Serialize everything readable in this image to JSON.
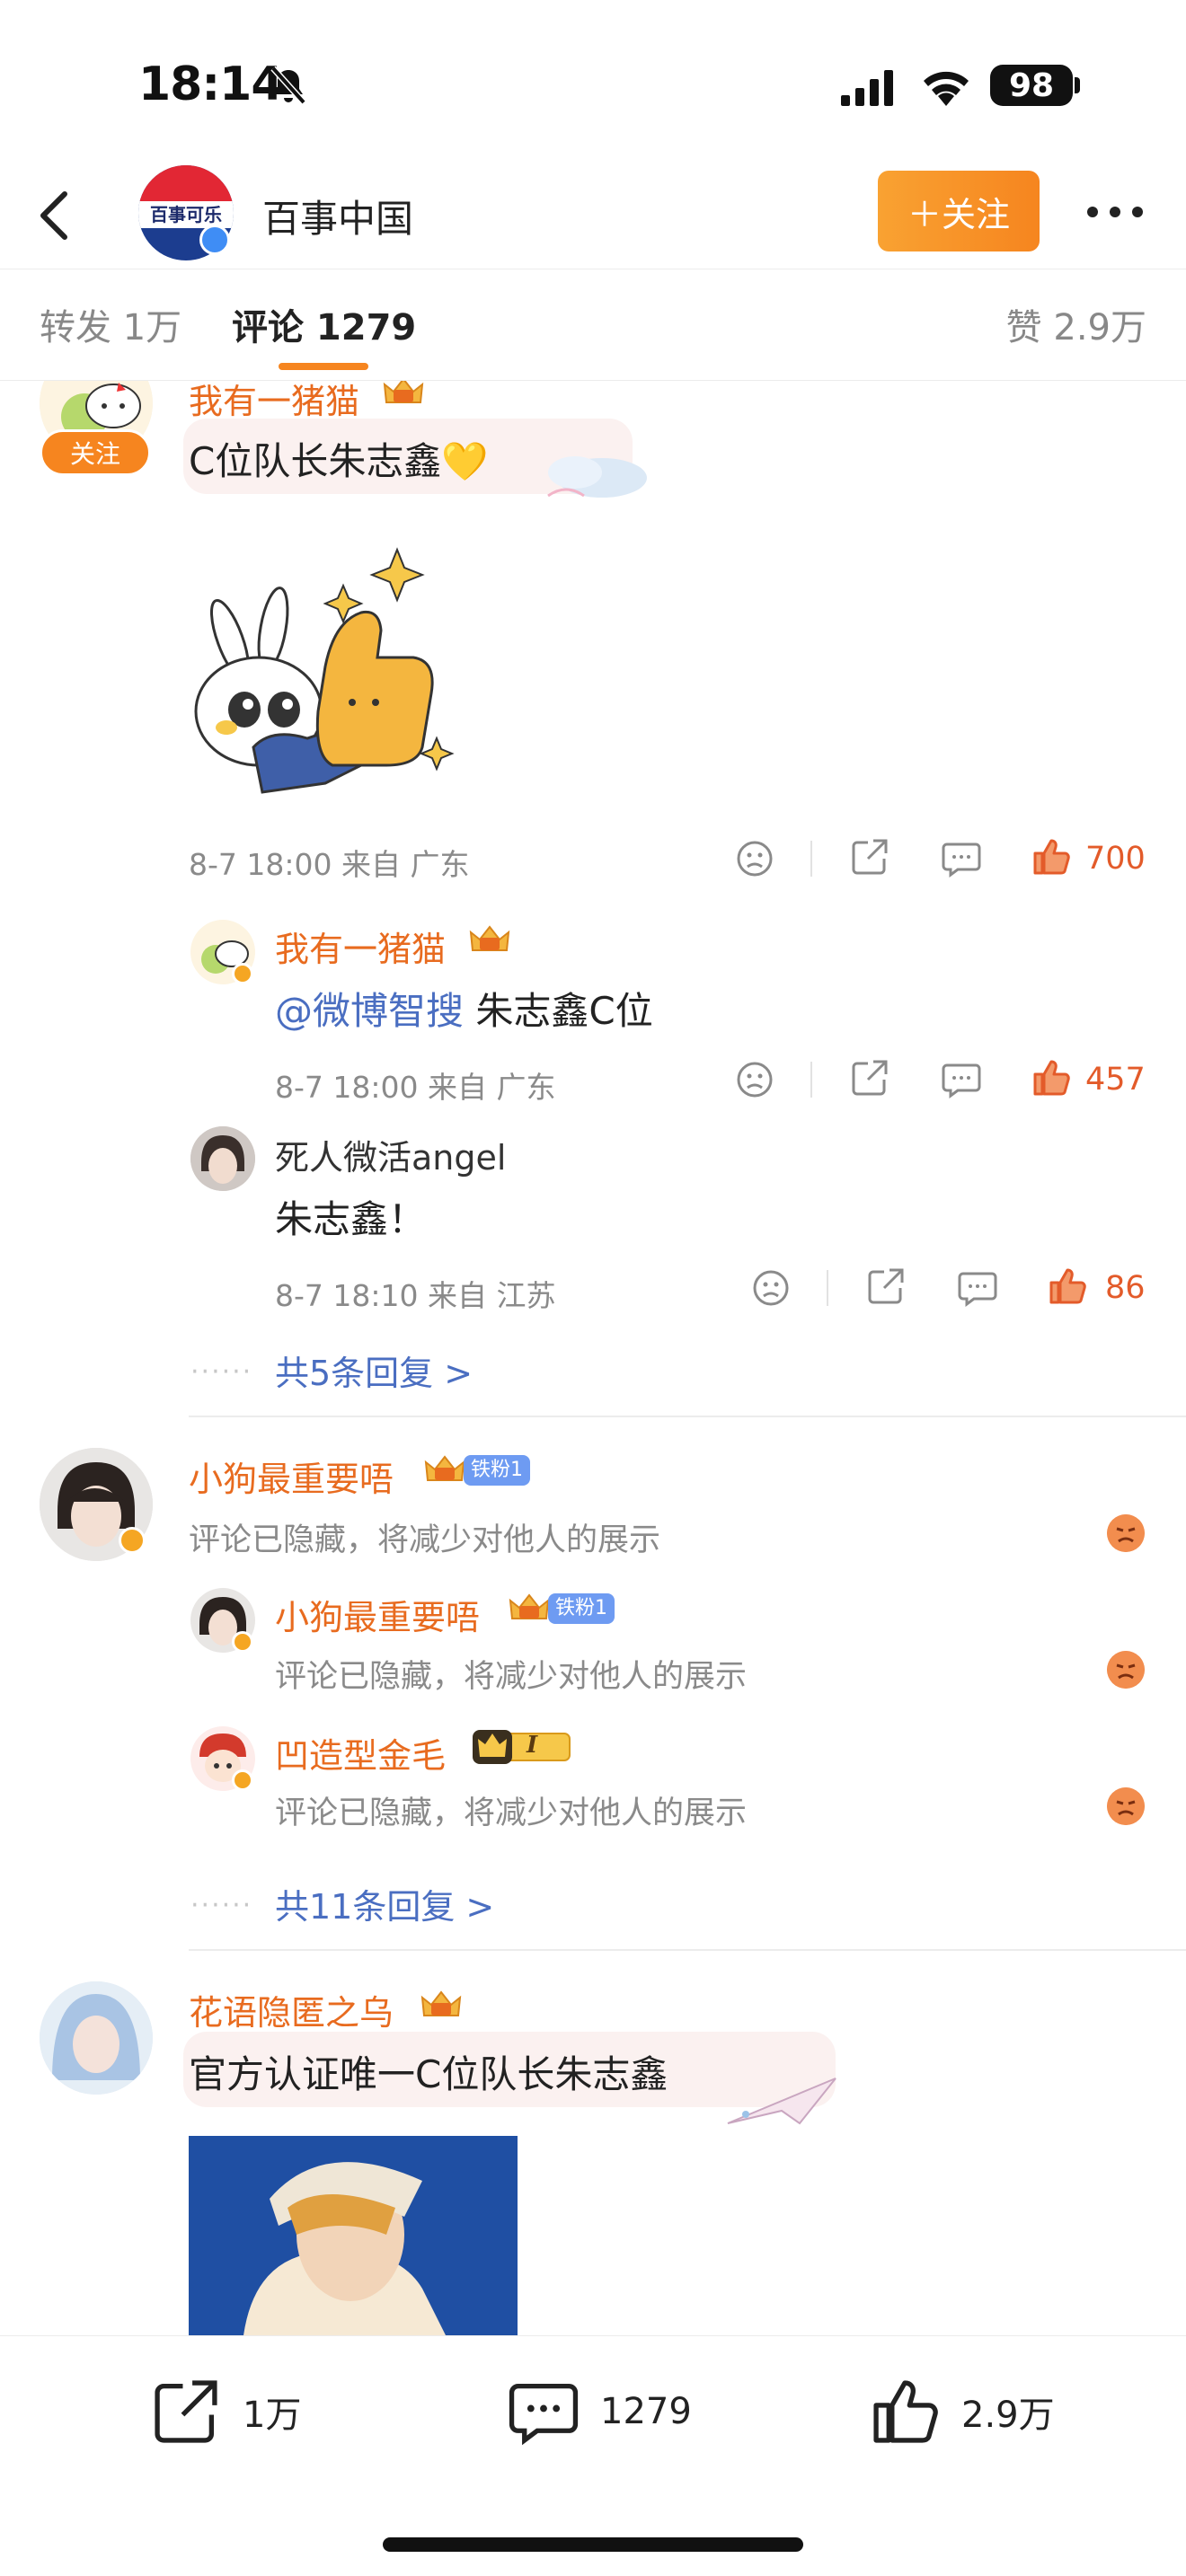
{
  "status_bar": {
    "time": "18:14",
    "battery": "98"
  },
  "nav": {
    "avatar_text": "百事可乐",
    "title": "百事中国",
    "follow_label": "＋关注"
  },
  "tabs": {
    "reposts": "转发 1万",
    "comments": "评论 1279",
    "likes": "赞 2.9万"
  },
  "comments": [
    {
      "username": "我有一猪猫",
      "follow_tag": "关注",
      "text": "C位队长朱志鑫💛",
      "meta": "8-7 18:00  来自 广东",
      "likes": "700",
      "replies": [
        {
          "username": "我有一猪猫",
          "mention": "@微博智搜",
          "text": " 朱志鑫C位",
          "meta": "8-7 18:00  来自 广东",
          "likes": "457"
        },
        {
          "username": "死人微活angel",
          "text": "朱志鑫！",
          "meta": "8-7 18:10  来自 江苏",
          "likes": "86"
        }
      ],
      "more_replies": "共5条回复 >"
    },
    {
      "username": "小狗最重要唔",
      "fan_badge": "铁粉1",
      "hidden_text": "评论已隐藏，将减少对他人的展示",
      "replies": [
        {
          "username": "小狗最重要唔",
          "fan_badge": "铁粉1",
          "hidden_text": "评论已隐藏，将减少对他人的展示"
        },
        {
          "username": "凹造型金毛",
          "level_badge": "I",
          "hidden_text": "评论已隐藏，将减少对他人的展示"
        }
      ],
      "more_replies": "共11条回复 >"
    },
    {
      "username": "花语隐匿之乌",
      "text": "官方认证唯一C位队长朱志鑫"
    }
  ],
  "bottom_bar": {
    "reposts": "1万",
    "comments": "1279",
    "likes": "2.9万"
  },
  "colors": {
    "accent": "#f6851f",
    "link": "#4a6ec1",
    "like": "#e35b2a",
    "username": "#e86b1f"
  }
}
